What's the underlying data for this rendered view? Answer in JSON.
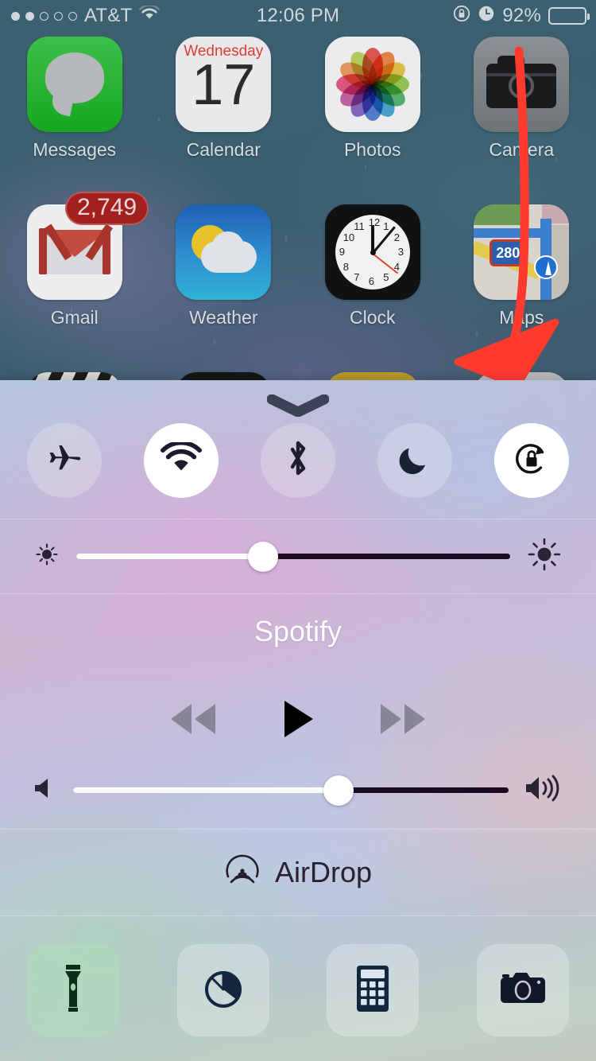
{
  "status_bar": {
    "signal_dots_filled": 2,
    "signal_dots_total": 5,
    "carrier": "AT&T",
    "wifi_icon": "wifi-icon",
    "time": "12:06 PM",
    "rotation_lock_icon": "rotation-lock-icon",
    "alarm_icon": "alarm-clock-icon",
    "battery_percent": "92%",
    "battery_level": 92
  },
  "home_screen": {
    "rows": [
      [
        {
          "label": "Messages",
          "icon": "messages-icon"
        },
        {
          "label": "Calendar",
          "icon": "calendar-icon",
          "weekday": "Wednesday",
          "day": "17"
        },
        {
          "label": "Photos",
          "icon": "photos-icon"
        },
        {
          "label": "Camera",
          "icon": "camera-icon"
        }
      ],
      [
        {
          "label": "Gmail",
          "icon": "gmail-icon",
          "badge": "2,749"
        },
        {
          "label": "Weather",
          "icon": "weather-icon"
        },
        {
          "label": "Clock",
          "icon": "clock-icon"
        },
        {
          "label": "Maps",
          "icon": "maps-icon",
          "route_shield": "280"
        }
      ],
      [
        {
          "label": "",
          "icon": "videos-icon"
        },
        {
          "label": "",
          "icon": "wallet-icon"
        },
        {
          "label": "",
          "icon": "notes-icon"
        },
        {
          "label": "",
          "icon": "settings-icon"
        }
      ]
    ]
  },
  "annotation": {
    "type": "red-arrow",
    "color": "#FF3B30",
    "points_to": "settings-icon"
  },
  "control_center": {
    "grabber_icon": "chevron-down-grabber",
    "toggles": [
      {
        "name": "airplane-mode",
        "icon": "airplane-icon",
        "active": false
      },
      {
        "name": "wifi",
        "icon": "wifi-icon",
        "active": true
      },
      {
        "name": "bluetooth",
        "icon": "bluetooth-icon",
        "active": false
      },
      {
        "name": "do-not-disturb",
        "icon": "moon-icon",
        "active": false
      },
      {
        "name": "rotation-lock",
        "icon": "rotation-lock-icon",
        "active": true
      }
    ],
    "brightness": {
      "low_icon": "brightness-low-icon",
      "high_icon": "brightness-high-icon",
      "value": 43
    },
    "now_playing": {
      "title": "Spotify",
      "controls": [
        {
          "name": "rewind-button",
          "icon": "rewind-icon",
          "enabled": false
        },
        {
          "name": "play-button",
          "icon": "play-icon",
          "enabled": true
        },
        {
          "name": "fast-forward-button",
          "icon": "fast-forward-icon",
          "enabled": false
        }
      ],
      "volume": {
        "low_icon": "volume-mute-icon",
        "high_icon": "volume-high-icon",
        "value": 61
      }
    },
    "airdrop": {
      "icon": "airdrop-icon",
      "label": "AirDrop"
    },
    "shortcuts": [
      {
        "name": "flashlight",
        "icon": "flashlight-icon",
        "active": true
      },
      {
        "name": "timer",
        "icon": "timer-icon",
        "active": false
      },
      {
        "name": "calculator",
        "icon": "calculator-icon",
        "active": false
      },
      {
        "name": "camera",
        "icon": "camera-icon",
        "active": false
      }
    ]
  },
  "colors": {
    "accent_red": "#FF3B30",
    "toggle_on_bg": "#FFFFFF",
    "toggle_off_bg": "rgba(255,255,255,0.22)",
    "icon_dark": "#1E1B2E",
    "badge_red": "#A3201F"
  }
}
